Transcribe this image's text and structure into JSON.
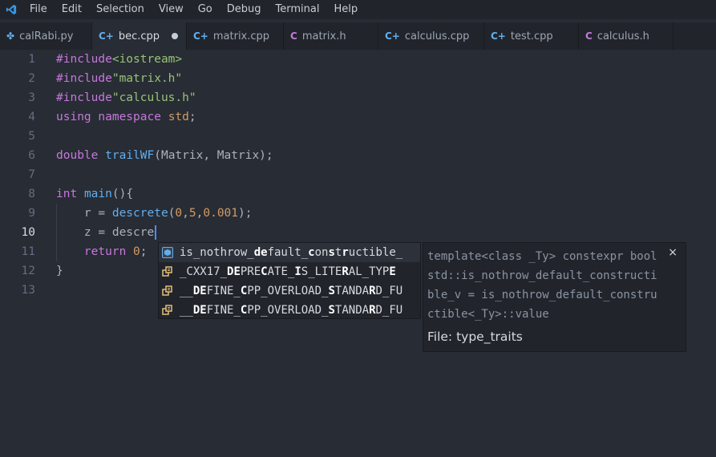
{
  "menu": [
    "File",
    "Edit",
    "Selection",
    "View",
    "Go",
    "Debug",
    "Terminal",
    "Help"
  ],
  "tabs": [
    {
      "label": "calRabi.py",
      "icon": "python-icon",
      "glyph": "✤",
      "color": "#61afef",
      "active": false,
      "dirty": false
    },
    {
      "label": "bec.cpp",
      "icon": "cpp-icon",
      "glyph": "C+",
      "color": "#61afef",
      "active": true,
      "dirty": true
    },
    {
      "label": "matrix.cpp",
      "icon": "cpp-icon",
      "glyph": "C+",
      "color": "#61afef",
      "active": false,
      "dirty": false
    },
    {
      "label": "matrix.h",
      "icon": "c-header-icon",
      "glyph": "C",
      "color": "#c678dd",
      "active": false,
      "dirty": false
    },
    {
      "label": "calculus.cpp",
      "icon": "cpp-icon",
      "glyph": "C+",
      "color": "#61afef",
      "active": false,
      "dirty": false
    },
    {
      "label": "test.cpp",
      "icon": "cpp-icon",
      "glyph": "C+",
      "color": "#61afef",
      "active": false,
      "dirty": false
    },
    {
      "label": "calculus.h",
      "icon": "c-header-icon",
      "glyph": "C",
      "color": "#c678dd",
      "active": false,
      "dirty": false
    }
  ],
  "editor": {
    "current_line": 10,
    "lines": [
      {
        "n": "1",
        "tokens": [
          [
            "kw",
            "#include"
          ],
          [
            "str",
            "<iostream>"
          ]
        ]
      },
      {
        "n": "2",
        "tokens": [
          [
            "kw",
            "#include"
          ],
          [
            "str",
            "\"matrix.h\""
          ]
        ]
      },
      {
        "n": "3",
        "tokens": [
          [
            "kw",
            "#include"
          ],
          [
            "str",
            "\"calculus.h\""
          ]
        ]
      },
      {
        "n": "4",
        "tokens": [
          [
            "kw",
            "using"
          ],
          [
            "plain",
            " "
          ],
          [
            "kw",
            "namespace"
          ],
          [
            "plain",
            " "
          ],
          [
            "num",
            "std"
          ],
          [
            "plain",
            ";"
          ]
        ]
      },
      {
        "n": "5",
        "tokens": []
      },
      {
        "n": "6",
        "tokens": [
          [
            "kw",
            "double"
          ],
          [
            "plain",
            " "
          ],
          [
            "fn",
            "trailWF"
          ],
          [
            "plain",
            "(Matrix, Matrix);"
          ]
        ]
      },
      {
        "n": "7",
        "tokens": []
      },
      {
        "n": "8",
        "tokens": [
          [
            "kw",
            "int"
          ],
          [
            "plain",
            " "
          ],
          [
            "fn",
            "main"
          ],
          [
            "plain",
            "(){"
          ]
        ]
      },
      {
        "n": "9",
        "tokens": [
          [
            "plain",
            "    r = "
          ],
          [
            "fn",
            "descrete"
          ],
          [
            "plain",
            "("
          ],
          [
            "num",
            "0"
          ],
          [
            "plain",
            ","
          ],
          [
            "num",
            "5"
          ],
          [
            "plain",
            ","
          ],
          [
            "num",
            "0.001"
          ],
          [
            "plain",
            ");"
          ]
        ]
      },
      {
        "n": "10",
        "tokens": [
          [
            "plain",
            "    z = descre"
          ]
        ]
      },
      {
        "n": "11",
        "tokens": [
          [
            "plain",
            "    "
          ],
          [
            "kw",
            "return"
          ],
          [
            "plain",
            " "
          ],
          [
            "num",
            "0"
          ],
          [
            "plain",
            ";"
          ]
        ]
      },
      {
        "n": "12",
        "tokens": [
          [
            "plain",
            "}"
          ]
        ]
      },
      {
        "n": "13",
        "tokens": []
      }
    ]
  },
  "suggestions": [
    {
      "kind": "variable",
      "icon": "variable-icon",
      "selected": true,
      "parts": [
        [
          "",
          "is_nothrow_"
        ],
        [
          "hl",
          "de"
        ],
        [
          "",
          "fault_"
        ],
        [
          "hl",
          "c"
        ],
        [
          "",
          "on"
        ],
        [
          "hl",
          "s"
        ],
        [
          "",
          "t"
        ],
        [
          "hl",
          "r"
        ],
        [
          "",
          "uctible_"
        ]
      ]
    },
    {
      "kind": "constant",
      "icon": "constant-icon",
      "selected": false,
      "parts": [
        [
          "",
          "_CXX17_"
        ],
        [
          "hl",
          "DE"
        ],
        [
          "",
          "PRE"
        ],
        [
          "hl",
          "C"
        ],
        [
          "",
          "ATE_"
        ],
        [
          "hl",
          "I"
        ],
        [
          "",
          "S_LITE"
        ],
        [
          "hl",
          "R"
        ],
        [
          "",
          "AL_TYP"
        ],
        [
          "hl",
          "E"
        ]
      ]
    },
    {
      "kind": "constant",
      "icon": "constant-icon",
      "selected": false,
      "parts": [
        [
          "",
          "__"
        ],
        [
          "hl",
          "DE"
        ],
        [
          "",
          "FINE_"
        ],
        [
          "hl",
          "C"
        ],
        [
          "",
          "PP_OVERLOAD_"
        ],
        [
          "hl",
          "S"
        ],
        [
          "",
          "TANDA"
        ],
        [
          "hl",
          "R"
        ],
        [
          "",
          "D_FU"
        ]
      ]
    },
    {
      "kind": "constant",
      "icon": "constant-icon",
      "selected": false,
      "parts": [
        [
          "",
          "__"
        ],
        [
          "hl",
          "DE"
        ],
        [
          "",
          "FINE_"
        ],
        [
          "hl",
          "C"
        ],
        [
          "",
          "PP_OVERLOAD_"
        ],
        [
          "hl",
          "S"
        ],
        [
          "",
          "TANDA"
        ],
        [
          "hl",
          "R"
        ],
        [
          "",
          "D_FU"
        ]
      ]
    }
  ],
  "details": {
    "signature": "template<class _Ty> constexpr bool std::is_nothrow_default_constructible_v = is_nothrow_default_constructible<_Ty>::value",
    "file": "File: type_traits",
    "close_glyph": "×"
  }
}
